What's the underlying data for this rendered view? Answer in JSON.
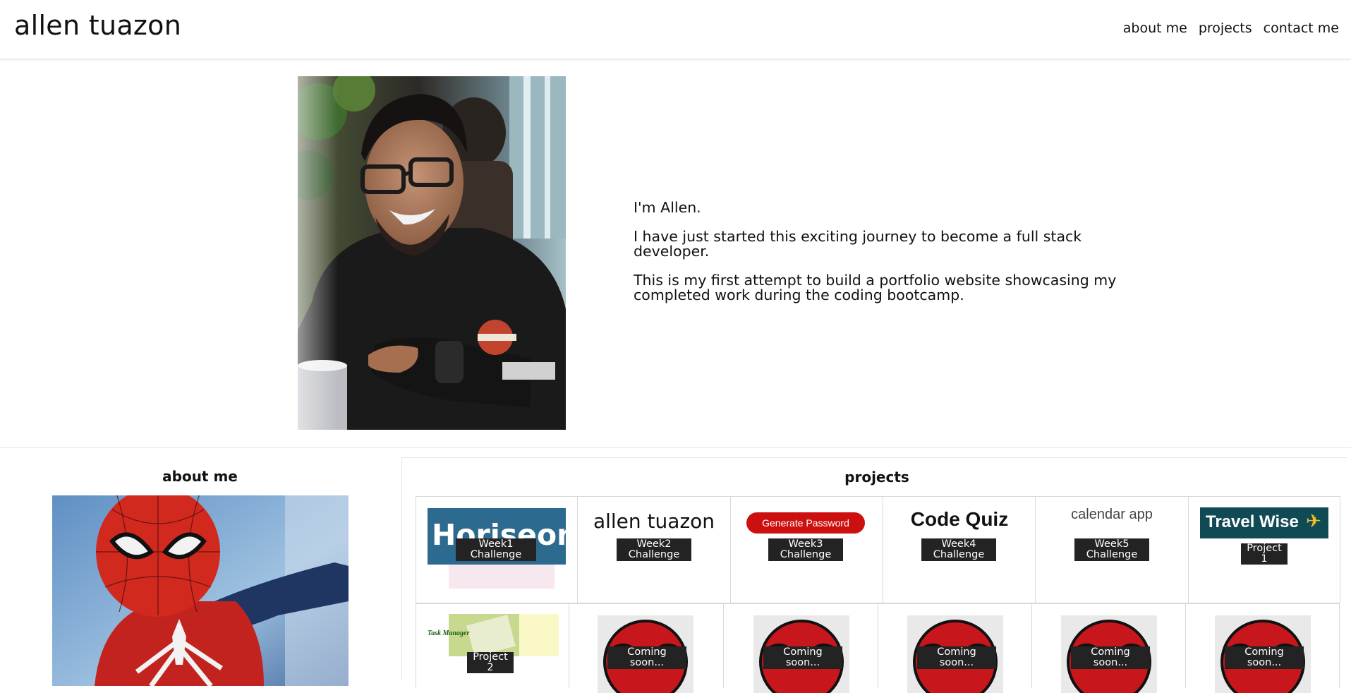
{
  "header": {
    "brand": "allen tuazon",
    "nav": [
      "about me",
      "projects",
      "contact me"
    ]
  },
  "hero": {
    "paragraphs": [
      "I'm Allen.",
      "I have just started this exciting journey to become a full stack developer.",
      "This is my first attempt to build a portfolio website showcasing my completed work during the coding bootcamp."
    ]
  },
  "about": {
    "title": "about me"
  },
  "projects": {
    "title": "projects",
    "row1": [
      {
        "thumb_text": "Horiseon",
        "caption_line1": "Week1",
        "caption_line2": "Challenge"
      },
      {
        "thumb_text": "allen tuazon",
        "caption_line1": "Week2",
        "caption_line2": "Challenge"
      },
      {
        "thumb_text": "Generate Password",
        "caption_line1": "Week3",
        "caption_line2": "Challenge"
      },
      {
        "thumb_text": "Code Quiz",
        "caption_line1": "Week4",
        "caption_line2": "Challenge"
      },
      {
        "thumb_text": "calendar app",
        "caption_line1": "Week5",
        "caption_line2": "Challenge"
      },
      {
        "thumb_text": "Travel Wise",
        "caption": "Project 1"
      }
    ],
    "row2": [
      {
        "thumb_text": "Task Manager",
        "caption": "Project 2"
      },
      {
        "caption_line1": "Coming",
        "caption_line2": "soon..."
      },
      {
        "caption_line1": "Coming",
        "caption_line2": "soon..."
      },
      {
        "caption_line1": "Coming",
        "caption_line2": "soon..."
      },
      {
        "caption_line1": "Coming",
        "caption_line2": "soon..."
      },
      {
        "caption_line1": "Coming",
        "caption_line2": "soon..."
      }
    ]
  },
  "colors": {
    "horiseon_bg": "#2d6a8f",
    "password_red": "#cc1010",
    "travelwise_bg": "#0f4a55",
    "travelwise_plane": "#f4c025",
    "spider_red": "#c8171c",
    "caption_bg": "#232323"
  }
}
